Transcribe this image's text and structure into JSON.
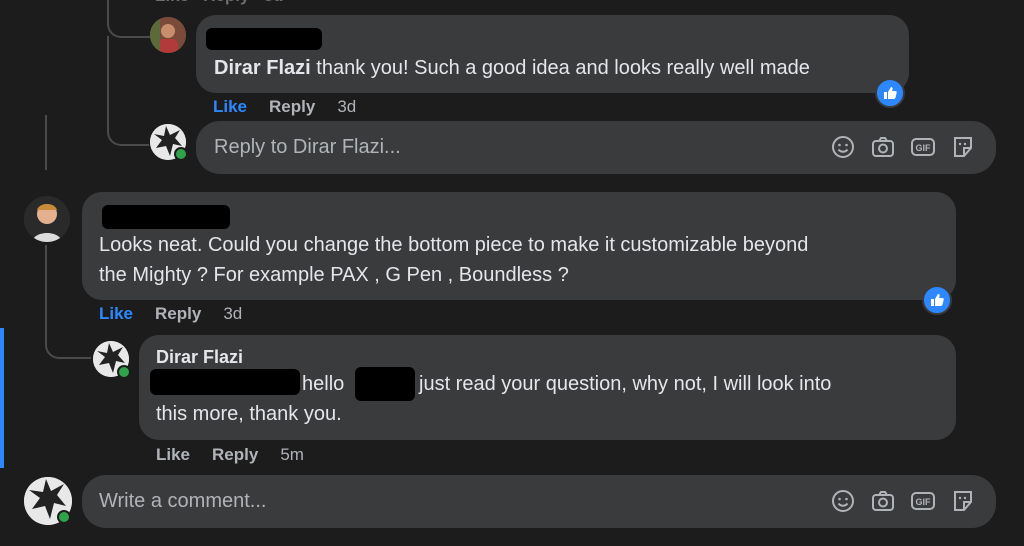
{
  "thread": {
    "top_reply": {
      "author": "Dirar Flazi",
      "text": "thank you! Such a good idea and looks really well made",
      "actions": {
        "like": "Like",
        "reply": "Reply",
        "time": "3d"
      }
    },
    "reply_box_1": {
      "placeholder": "Reply to Dirar Flazi..."
    },
    "comment": {
      "text_line1": "Looks neat. Could you change the bottom piece to make it customizable beyond",
      "text_line2": "the Mighty ? For example PAX , G Pen , Boundless ?",
      "actions": {
        "like": "Like",
        "reply": "Reply",
        "time": "3d"
      }
    },
    "reply": {
      "author": "Dirar Flazi",
      "text_a": "hello",
      "text_b": "just read your question, why not, I will look into",
      "text_line2": "this more, thank you.",
      "actions": {
        "like": "Like",
        "reply": "Reply",
        "time": "5m"
      }
    },
    "write_comment": {
      "placeholder": "Write a comment..."
    },
    "colors": {
      "accent": "#2d88ff",
      "bubble": "#3a3b3c",
      "background": "#1c1c1d"
    },
    "icons": [
      "smile-icon",
      "camera-icon",
      "gif-icon",
      "sticker-icon",
      "like-reaction-icon"
    ]
  }
}
